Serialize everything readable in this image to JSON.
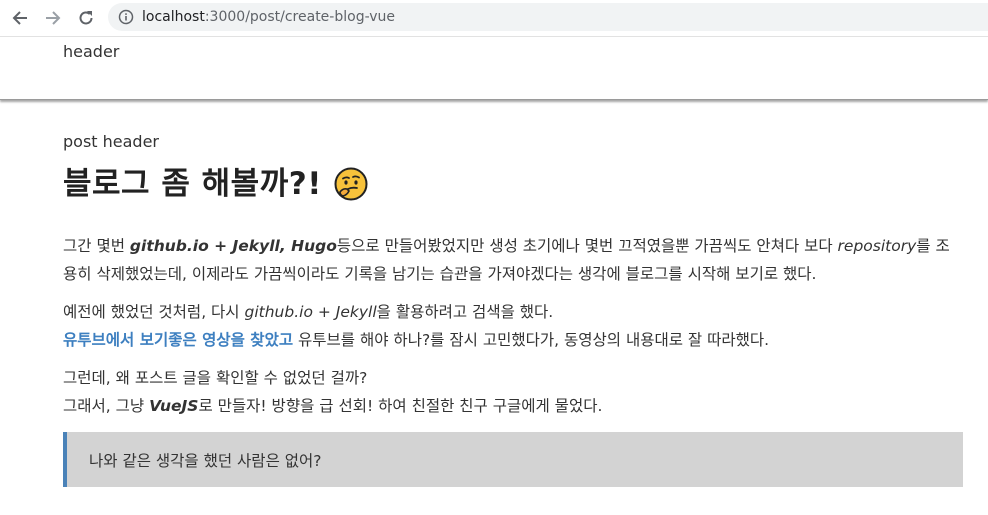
{
  "browser": {
    "url_host": "localhost",
    "url_path": ":3000/post/create-blog-vue",
    "icons": [
      "back-arrow-icon",
      "forward-arrow-icon",
      "reload-icon",
      "info-icon"
    ]
  },
  "site_header": {
    "text": "header"
  },
  "post": {
    "header_label": "post header",
    "title": "블로그 좀 해볼까?!",
    "title_emoji": "thinking-face-icon",
    "p1": {
      "t1": "그간 몇번 ",
      "b1": "github.io + Jekyll, Hugo",
      "t2": "등으로 만들어봤었지만 생성 초기에나 몇번 끄적였을뿐 가끔씩도 안쳐다 보다 ",
      "i1": "repository",
      "t3": "를 조용히 삭제했었는데, 이제라도 가끔씩이라도 기록을 남기는 습관을 가져야겠다는 생각에 블로그를 시작해 보기로 했다."
    },
    "p2": {
      "t1": "예전에 했었던 것처럼, 다시 ",
      "i1": "github.io + Jekyll",
      "t2": "을 활용하려고 검색을 했다.",
      "link": "유투브에서 보기좋은 영상을 찾았고",
      "t3": " 유투브를 해야 하나?를 잠시 고민했다가, 동영상의 내용대로 잘 따라했다."
    },
    "p3": {
      "line1": "그런데, 왜 포스트 글을 확인할 수 없었던 걸까?",
      "t1": "그래서, 그냥 ",
      "b1": "VueJS",
      "t2": "로 만들자! 방향을 급 선회! 하여 친절한 친구 구글에게 물었다."
    },
    "quote": "나와 같은 생각을 했던 사람은 없어?"
  },
  "colors": {
    "link": "#3d7fc0",
    "quote_bg": "#d3d3d3",
    "quote_border": "#4a82b8"
  }
}
